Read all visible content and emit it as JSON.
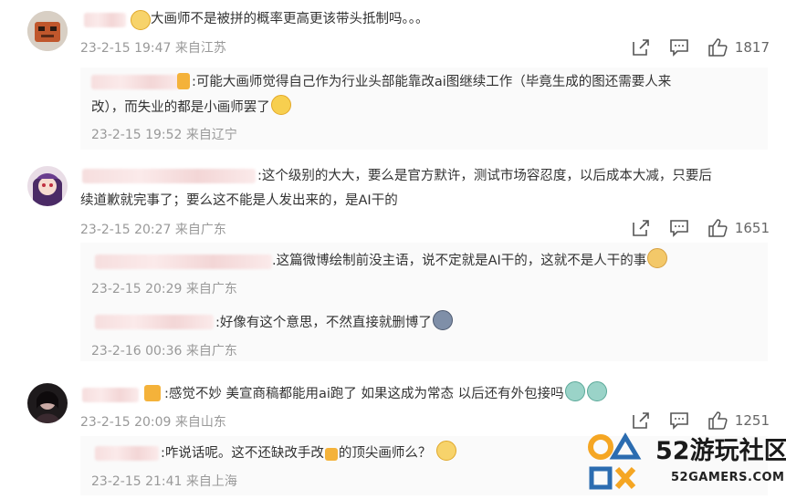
{
  "comments": [
    {
      "text": "大画师不是被拼的概率更高更该带头抵制吗。。。",
      "date": "23-2-15 19:47",
      "location": "来自江苏",
      "likes": "1817",
      "replies": [
        {
          "text_line1": ":可能大画师觉得自己作为行业头部能靠改ai图继续工作（毕竟生成的图还需要人来",
          "text_line2": "改），而失业的都是小画师罢了",
          "date": "23-2-15 19:52",
          "location": "来自辽宁"
        }
      ]
    },
    {
      "text_line1": ":这个级别的大大，要么是官方默许，测试市场容忍度，以后成本大减，只要后",
      "text_line2": "续道歉就完事了；要么这不能是人发出来的，是AI干的",
      "date": "23-2-15 20:27",
      "location": "来自广东",
      "likes": "1651",
      "replies": [
        {
          "text": ".这篇微博绘制前没主语，说不定就是AI干的，这就不是人干的事",
          "date": "23-2-15 20:29",
          "location": "来自广东"
        },
        {
          "text": ":好像有这个意思，不然直接就删博了",
          "date": "23-2-16 00:36",
          "location": "来自广东"
        }
      ]
    },
    {
      "text": ":感觉不妙 美宣商稿都能用ai跑了 如果这成为常态 以后还有外包接吗",
      "date": "23-2-15 20:09",
      "location": "来自山东",
      "likes": "1251",
      "replies": [
        {
          "text_prefix": ":咋说话呢。这不还缺改手改",
          "text_suffix": "的顶尖画师么？",
          "date": "23-2-15 21:41",
          "location": "来自上海"
        }
      ]
    }
  ],
  "icons": {
    "share": "share-icon",
    "comment": "comment-icon",
    "like": "thumbs-up-icon"
  },
  "watermark": {
    "title": "52游玩社区",
    "subtitle": "52GAMERS.COM"
  },
  "colors": {
    "text": "#333333",
    "meta": "#999999",
    "icon": "#555555",
    "logo_orange": "#f5a623",
    "logo_blue": "#2b6cb0"
  }
}
